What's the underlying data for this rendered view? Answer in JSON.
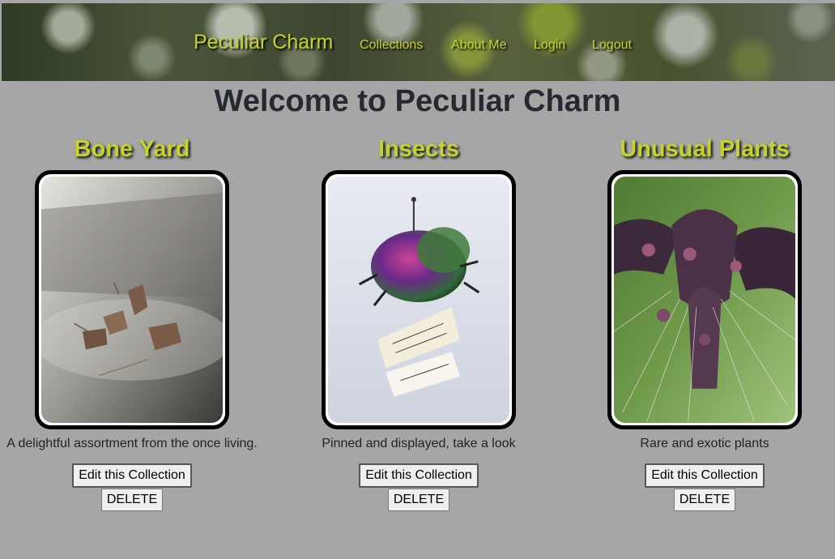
{
  "header": {
    "brand": "Peculiar Charm",
    "nav": [
      "Collections",
      "About Me",
      "Login",
      "Logout"
    ]
  },
  "page": {
    "title": "Welcome to Peculiar Charm"
  },
  "collections": [
    {
      "title": "Bone Yard",
      "description": "A delightful assortment from the once living.",
      "edit_label": "Edit this Collection",
      "delete_label": "DELETE",
      "image": "bone-pods-photo"
    },
    {
      "title": "Insects",
      "description": "Pinned and displayed, take a look",
      "edit_label": "Edit this Collection",
      "delete_label": "DELETE",
      "image": "pinned-beetle-photo"
    },
    {
      "title": "Unusual Plants",
      "description": "Rare and exotic plants",
      "edit_label": "Edit this Collection",
      "delete_label": "DELETE",
      "image": "bat-flower-photo"
    }
  ],
  "colors": {
    "accent": "#c5d22e",
    "background": "#a6a6a6",
    "title": "#262a30"
  }
}
